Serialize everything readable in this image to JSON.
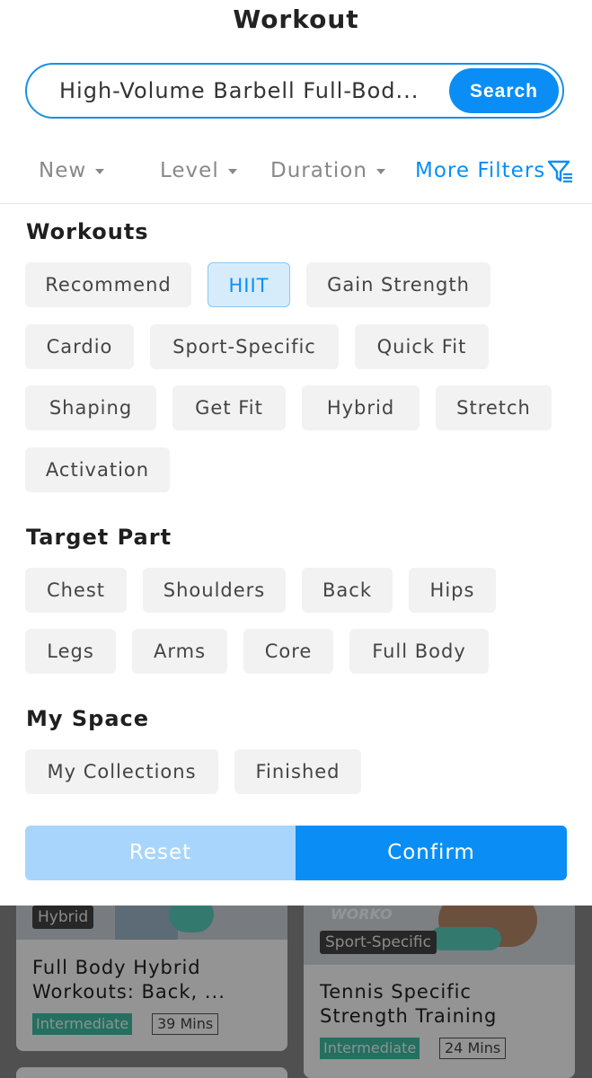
{
  "header": {
    "title": "Workout"
  },
  "search": {
    "value": "High-Volume Barbell Full-Bod...",
    "button_label": "Search"
  },
  "filters": {
    "new": "New",
    "level": "Level",
    "duration": "Duration",
    "more": "More Filters"
  },
  "workouts": {
    "title": "Workouts",
    "chips": [
      "Recommend",
      "HIIT",
      "Gain Strength",
      "Cardio",
      "Sport-Specific",
      "Quick Fit",
      "Shaping",
      "Get Fit",
      "Hybrid",
      "Stretch",
      "Activation"
    ],
    "selected": "HIIT"
  },
  "target_part": {
    "title": "Target Part",
    "chips": [
      "Chest",
      "Shoulders",
      "Back",
      "Hips",
      "Legs",
      "Arms",
      "Core",
      "Full Body"
    ]
  },
  "my_space": {
    "title": "My Space",
    "chips": [
      "My Collections",
      "Finished"
    ]
  },
  "actions": {
    "reset": "Reset",
    "confirm": "Confirm"
  },
  "background_cards": [
    {
      "badge": "Hybrid",
      "title_line1": "Full Body Hybrid",
      "title_line2": "Workouts: Back, ...",
      "level": "Intermediate",
      "duration": "39 Mins"
    },
    {
      "badge": "Sport-Specific",
      "image_text": "WORKO",
      "title_line1": "Tennis Specific",
      "title_line2": "Strength Training",
      "level": "Intermediate",
      "duration": "24 Mins"
    }
  ],
  "colors": {
    "accent": "#0a8ef5",
    "accent_light": "#a8d5fb",
    "chip_bg": "#f2f2f2",
    "level_tag": "#3fc0a5"
  }
}
